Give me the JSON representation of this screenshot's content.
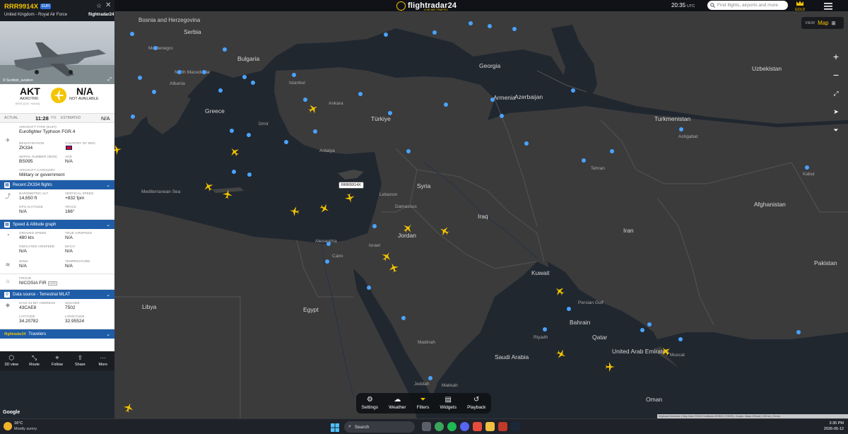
{
  "flight": {
    "callsign": "RRR9914X",
    "type_badge": "EUFI",
    "operator": "United Kingdom - Royal Air Force",
    "brand_mini": "flightradar24",
    "photo_credit": "© Scottish_aviation",
    "origin": {
      "code": "AKT",
      "name": "AKROTIRI",
      "tz": "EEST (UTC +03:00)"
    },
    "destination": {
      "code": "N/A",
      "name": "NOT AVAILABLE"
    },
    "times": {
      "actual_label": "ACTUAL",
      "actual_value": "11:28",
      "actual_suffix": "PM",
      "estimated_label": "ESTIMATED",
      "estimated_value": "N/A"
    },
    "aircraft": {
      "type_label": "AIRCRAFT TYPE (EUFI)",
      "type_value": "Eurofighter Typhoon FGR.4",
      "reg_label": "REGISTRATION",
      "reg_value": "ZK334",
      "country_label": "COUNTRY OF REG.",
      "msn_label": "SERIAL NUMBER (MSN)",
      "msn_value": "BS095",
      "age_label": "AGE",
      "age_value": "N/A",
      "cat_label": "AIRCRAFT CATEGORY",
      "cat_value": "Military or government"
    },
    "recent_flights_label": "Recent ZK334 flights",
    "altitude": {
      "baro_label": "BAROMETRIC ALT.",
      "baro_value": "14,650 ft",
      "vs_label": "VERTICAL SPEED",
      "vs_value": "+832 fpm",
      "gps_label": "GPS ALTITUDE",
      "gps_value": "N/A",
      "track_label": "TRACK",
      "track_value": "166°"
    },
    "speed_graph_label": "Speed & Altitude graph",
    "speed": {
      "gs_label": "GROUND SPEED",
      "gs_value": "480 kts",
      "tas_label": "TRUE AIRSPEED",
      "tas_value": "N/A",
      "ias_label": "INDICATED AIRSPEED",
      "ias_value": "N/A",
      "mach_label": "MACH",
      "mach_value": "N/A",
      "wind_label": "WIND",
      "wind_value": "N/A",
      "temp_label": "TEMPERATURE",
      "temp_value": "N/A"
    },
    "fir": {
      "label": "FIR/UIR",
      "value": "NICOSIA FIR",
      "badge": "LCCC"
    },
    "datasource_label": "Data source - Terrestrial MLAT",
    "position": {
      "icao_label": "ICAO 24-BIT ADDRESS",
      "icao_value": "43CAE8",
      "squawk_label": "SQUAWK",
      "squawk_value": "7502",
      "lat_label": "LATITUDE",
      "lat_value": "34.20782",
      "lon_label": "LONGITUDE",
      "lon_value": "32.95524"
    },
    "travelers_brand": "flightradar24",
    "travelers_label": "Travelers",
    "footer": [
      "3D view",
      "Route",
      "Follow",
      "Share",
      "More"
    ]
  },
  "topbar": {
    "logo": "flightradar24",
    "logo_sub": "LIVE AIR TRAFFIC",
    "time": "20:35",
    "time_zone": "UTC",
    "search_placeholder": "Find flights, airports and more",
    "gold_label": "GOLD",
    "view_label": "VIEW",
    "view_value": "Map"
  },
  "map": {
    "selected_label": "RRR9914X",
    "labels": {
      "bosnia": "Bosnia and Herzegovina",
      "serbia": "Serbia",
      "montenegro": "Montenegro",
      "north_macedonia": "North Macedonia",
      "bulgaria": "Bulgaria",
      "albania": "Albania",
      "greece": "Greece",
      "georgia": "Georgia",
      "armenia": "Armenia",
      "azerbaijan": "Azerbaijan",
      "turkiye": "Türkiye",
      "ankara": "Ankara",
      "istanbul": "Istanbul",
      "izmir": "İzmir",
      "antalya": "Antalya",
      "syria": "Syria",
      "lebanon": "Lebanon",
      "damascus": "Damascus",
      "iraq": "Iraq",
      "israel": "Israel",
      "jordan": "Jordan",
      "alexandria": "Alexandria",
      "cairo": "Cairo",
      "egypt": "Egypt",
      "libya": "Libya",
      "med_sea": "Mediterranean Sea",
      "uzbekistan": "Uzbekistan",
      "turkmenistan": "Turkmenistan",
      "ashgabat": "Ashgabat",
      "tehran": "Tehran",
      "iran": "Iran",
      "afghanistan": "Afghanistan",
      "kabul": "Kabul",
      "pakistan": "Pakistan",
      "kuwait": "Kuwait",
      "bahrain": "Bahrain",
      "qatar": "Qatar",
      "riyadh": "Riyadh",
      "saudi": "Saudi Arabia",
      "uae": "United Arab Emirates",
      "muscat": "Muscat",
      "oman": "Oman",
      "medina": "Madinah",
      "jeddah": "Jeddah",
      "makkah": "Makkah",
      "persian_gulf": "Persian Gulf"
    },
    "toolbar": [
      "Settings",
      "Weather",
      "Filters",
      "Widgets",
      "Playback"
    ],
    "attribution": "Keyboard shortcuts | Map Data ©2026 GeoBasis-DE/BKG (©2009), Google, Mapa GISrael | 200 km | Terms",
    "google": "Google"
  },
  "taskbar": {
    "temp": "16°C",
    "weather": "Mostly sunny",
    "search": "Search",
    "time": "3:35 PM",
    "date": "2026-05-12"
  },
  "colors": {
    "accent": "#f5c400",
    "section": "#1f5da8",
    "map_land": "#3b3b3c",
    "map_sea": "#20272f"
  }
}
